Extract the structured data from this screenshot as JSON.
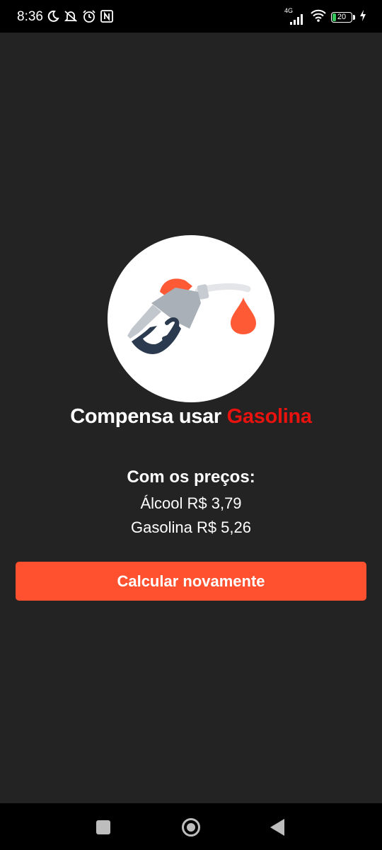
{
  "status_bar": {
    "time": "8:36",
    "network_type": "4G",
    "battery_level": "20",
    "battery_percent": 20,
    "icons_left": [
      "moon-icon",
      "muted-bell-icon",
      "alarm-icon",
      "nfc-icon"
    ],
    "icons_right": [
      "signal-icon",
      "wifi-icon",
      "battery-icon",
      "charging-icon"
    ]
  },
  "logo": {
    "icon": "fuel-pump-icon",
    "colors": {
      "circle": "#ffffff",
      "nozzle_body": "#a9b0b8",
      "nozzle_cap": "#ff5a36",
      "handle": "#2b3a4e",
      "drop": "#ff5a36"
    }
  },
  "result": {
    "prefix": "Compensa usar ",
    "fuel": "Gasolina"
  },
  "prices": {
    "title": "Com os preços:",
    "alcool": "Álcool R$ 3,79",
    "gasolina": "Gasolina R$ 5,26"
  },
  "button": {
    "label": "Calcular novamente"
  },
  "colors": {
    "background": "#232323",
    "accent": "#ff512f",
    "highlight": "#e8120f",
    "text": "#ffffff"
  },
  "nav_bar": {
    "buttons": [
      "recents-button",
      "home-button",
      "back-button"
    ]
  }
}
